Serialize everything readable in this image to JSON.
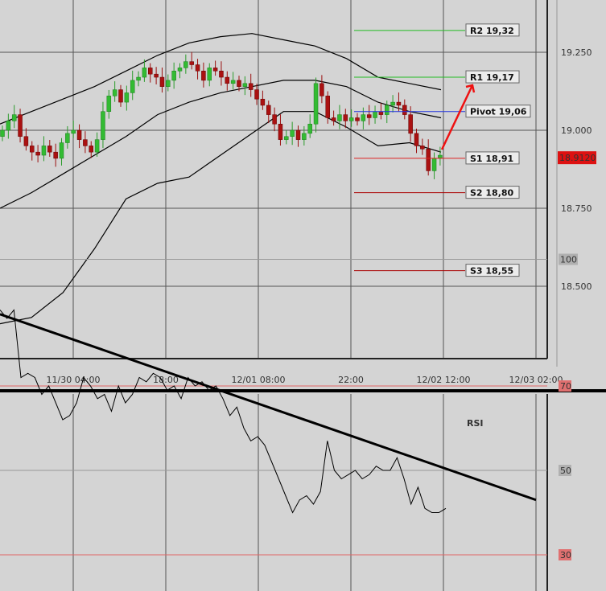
{
  "chart_data": [
    {
      "type": "candlestick",
      "title": "",
      "ylim": [
        18.38,
        19.52
      ],
      "y_ticks": [
        "19.250",
        "19.000",
        "18.750",
        "18.500"
      ],
      "x_ticks": [
        "11/30 04:00",
        "18:00",
        "12/01 08:00",
        "22:00",
        "12/02 12:00",
        "12/03 02:00"
      ],
      "current_price": "18.9120",
      "pivot_levels": [
        {
          "label": "R2 19,32",
          "value": 19.32,
          "color": "#22bb22"
        },
        {
          "label": "R1 19,17",
          "value": 19.17,
          "color": "#22bb22"
        },
        {
          "label": "Pivot 19,06",
          "value": 19.06,
          "color": "#2233dd"
        },
        {
          "label": "S1 18,91",
          "value": 18.91,
          "color": "#dd2222"
        },
        {
          "label": "S2 18,80",
          "value": 18.8,
          "color": "#aa0000"
        },
        {
          "label": "S3 18,55",
          "value": 18.55,
          "color": "#aa0000"
        }
      ],
      "candles_close": [
        19.0,
        19.03,
        19.05,
        18.98,
        18.95,
        18.93,
        18.92,
        18.95,
        18.93,
        18.91,
        18.96,
        18.99,
        19.0,
        18.97,
        18.95,
        18.93,
        18.97,
        19.06,
        19.11,
        19.13,
        19.09,
        19.12,
        19.16,
        19.17,
        19.2,
        19.18,
        19.17,
        19.14,
        19.16,
        19.19,
        19.2,
        19.22,
        19.21,
        19.19,
        19.16,
        19.2,
        19.19,
        19.17,
        19.15,
        19.16,
        19.14,
        19.15,
        19.13,
        19.1,
        19.08,
        19.05,
        19.02,
        18.97,
        18.98,
        19.0,
        18.97,
        18.99,
        19.02,
        19.15,
        19.11,
        19.04,
        19.03,
        19.05,
        19.03,
        19.04,
        19.03,
        19.05,
        19.04,
        19.06,
        19.05,
        19.08,
        19.09,
        19.08,
        19.05,
        18.99,
        18.95,
        18.94,
        18.87,
        18.91,
        18.92
      ],
      "bollinger_upper": [
        19.02,
        19.06,
        19.1,
        19.14,
        19.19,
        19.24,
        19.28,
        19.3,
        19.31,
        19.29,
        19.27,
        19.23,
        19.17,
        19.15,
        19.13
      ],
      "bollinger_middle": [
        18.75,
        18.8,
        18.86,
        18.92,
        18.98,
        19.05,
        19.09,
        19.12,
        19.14,
        19.16,
        19.16,
        19.14,
        19.09,
        19.06,
        19.04
      ],
      "bollinger_lower": [
        18.38,
        18.4,
        18.48,
        18.62,
        18.78,
        18.83,
        18.85,
        18.92,
        18.99,
        19.06,
        19.06,
        19.01,
        18.95,
        18.96,
        18.93
      ]
    },
    {
      "type": "line",
      "title": "RSI",
      "ylim": [
        0,
        100
      ],
      "y_ticks": [
        "100",
        "70",
        "50",
        "30"
      ],
      "reference_lines": [
        70,
        30
      ],
      "values": [
        88,
        86,
        88,
        72,
        73,
        72,
        68,
        70,
        66,
        62,
        63,
        66,
        72,
        70,
        67,
        68,
        64,
        70,
        66,
        68,
        72,
        71,
        73,
        72,
        69,
        70,
        67,
        72,
        70,
        71,
        69,
        70,
        67,
        63,
        65,
        60,
        57,
        58,
        56,
        52,
        48,
        44,
        40,
        43,
        44,
        42,
        45,
        57,
        50,
        48,
        49,
        50,
        48,
        49,
        51,
        50,
        50,
        53,
        48,
        42,
        46,
        41,
        40,
        40,
        41
      ],
      "trendline": {
        "start": 87,
        "end": 43
      }
    }
  ]
}
